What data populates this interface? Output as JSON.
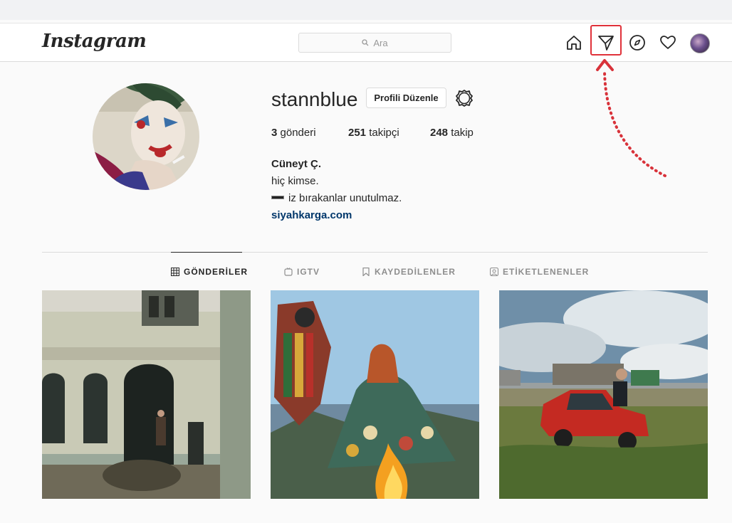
{
  "header": {
    "logo": "Instagram",
    "search_placeholder": "Ara"
  },
  "nav_icons": [
    "home-icon",
    "direct-message-icon",
    "explore-icon",
    "activity-heart-icon",
    "profile-avatar"
  ],
  "profile": {
    "username": "stannblue",
    "edit_button": "Profili Düzenle",
    "stats": {
      "posts_count": "3",
      "posts_label": "gönderi",
      "followers_count": "251",
      "followers_label": "takipçi",
      "following_count": "248",
      "following_label": "takip"
    },
    "bio": {
      "name": "Cüneyt Ç.",
      "line1": "hiç kimse.",
      "line2": "iz bırakanlar unutulmaz.",
      "link": "siyahkarga.com"
    }
  },
  "tabs": [
    {
      "label": "GÖNDERİLER",
      "active": true
    },
    {
      "label": "IGTV",
      "active": false
    },
    {
      "label": "KAYDEDİLENLER",
      "active": false
    },
    {
      "label": "ETİKETLENENLER",
      "active": false
    }
  ],
  "posts": [
    "abandoned-building-photo",
    "colorful-costume-fire-photo",
    "red-car-field-photo"
  ],
  "colors": {
    "highlight": "#e0323a",
    "link": "#00376b",
    "border": "#dbdbdb"
  }
}
